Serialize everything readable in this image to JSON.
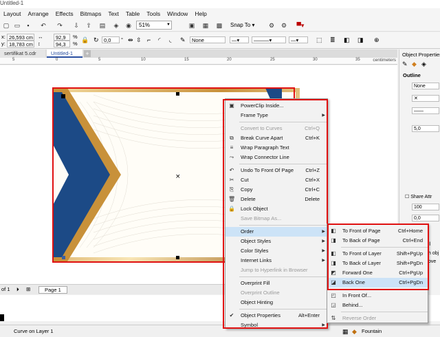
{
  "window": {
    "title": "Untitled-1"
  },
  "menubar": [
    "Layout",
    "Arrange",
    "Effects",
    "Bitmaps",
    "Text",
    "Table",
    "Tools",
    "Window",
    "Help"
  ],
  "toolbar": {
    "zoom": "51%",
    "snap_to": "Snap To"
  },
  "propbar": {
    "x": "26,593 cm",
    "y": "18,783 cm",
    "scale_w": "92,9",
    "scale_h": "94,3",
    "pct": "%",
    "rotation": "0,0",
    "degree": "°",
    "outline_width": "None"
  },
  "doc_tabs": {
    "inactive": "sertifikat 5.cdr",
    "active": "Untitled-1",
    "add": "+"
  },
  "ruler": {
    "labels": [
      "5",
      "0",
      "5",
      "10",
      "15",
      "20",
      "25",
      "30",
      "35"
    ],
    "unit": "centimeters"
  },
  "docker": {
    "title": "Object Properties",
    "section": "Outline",
    "fill_value": "None",
    "width_value": "5,0",
    "share_attr": "Share Attr",
    "value_100": "100",
    "value_00": "0,0",
    "frag1": "ll",
    "frag2": "h obj",
    "frag3": "ove"
  },
  "context_menu": {
    "items": [
      {
        "label": "PowerClip Inside...",
        "icon": "powerclip-icon",
        "shortcut": "",
        "submenu": false,
        "disabled": false
      },
      {
        "label": "Frame Type",
        "icon": "",
        "shortcut": "",
        "submenu": true,
        "disabled": false
      },
      {
        "sep": true
      },
      {
        "label": "Convert to Curves",
        "icon": "",
        "shortcut": "Ctrl+Q",
        "submenu": false,
        "disabled": true
      },
      {
        "label": "Break Curve Apart",
        "icon": "break-apart-icon",
        "shortcut": "Ctrl+K",
        "submenu": false,
        "disabled": false
      },
      {
        "label": "Wrap Paragraph Text",
        "icon": "wrap-text-icon",
        "shortcut": "",
        "submenu": false,
        "disabled": false
      },
      {
        "label": "Wrap Connector Line",
        "icon": "connector-icon",
        "shortcut": "",
        "submenu": false,
        "disabled": false
      },
      {
        "sep": true
      },
      {
        "label": "Undo To Front Of Page",
        "icon": "undo-icon",
        "shortcut": "Ctrl+Z",
        "submenu": false,
        "disabled": false
      },
      {
        "label": "Cut",
        "icon": "scissors-icon",
        "shortcut": "Ctrl+X",
        "submenu": false,
        "disabled": false
      },
      {
        "label": "Copy",
        "icon": "copy-icon",
        "shortcut": "Ctrl+C",
        "submenu": false,
        "disabled": false
      },
      {
        "label": "Delete",
        "icon": "trash-icon",
        "shortcut": "Delete",
        "submenu": false,
        "disabled": false
      },
      {
        "label": "Lock Object",
        "icon": "lock-icon",
        "shortcut": "",
        "submenu": false,
        "disabled": false
      },
      {
        "label": "Save Bitmap As...",
        "icon": "",
        "shortcut": "",
        "submenu": false,
        "disabled": true
      },
      {
        "sep": true
      },
      {
        "label": "Order",
        "icon": "",
        "shortcut": "",
        "submenu": true,
        "disabled": false,
        "highlight": true
      },
      {
        "label": "Object Styles",
        "icon": "",
        "shortcut": "",
        "submenu": true,
        "disabled": false
      },
      {
        "label": "Color Styles",
        "icon": "",
        "shortcut": "",
        "submenu": true,
        "disabled": false
      },
      {
        "label": "Internet Links",
        "icon": "",
        "shortcut": "",
        "submenu": true,
        "disabled": false
      },
      {
        "label": "Jump to Hyperlink in Browser",
        "icon": "",
        "shortcut": "",
        "submenu": false,
        "disabled": true
      },
      {
        "sep": true
      },
      {
        "label": "Overprint Fill",
        "icon": "",
        "shortcut": "",
        "submenu": false,
        "disabled": false
      },
      {
        "label": "Overprint Outline",
        "icon": "",
        "shortcut": "",
        "submenu": false,
        "disabled": true
      },
      {
        "label": "Object Hinting",
        "icon": "",
        "shortcut": "",
        "submenu": false,
        "disabled": false
      },
      {
        "sep": true
      },
      {
        "label": "Object Properties",
        "icon": "check-icon",
        "shortcut": "Alt+Enter",
        "submenu": false,
        "disabled": false
      },
      {
        "label": "Symbol",
        "icon": "",
        "shortcut": "",
        "submenu": true,
        "disabled": false
      }
    ]
  },
  "order_submenu": {
    "items": [
      {
        "label": "To Front of Page",
        "shortcut": "Ctrl+Home",
        "disabled": false,
        "icon": "front-page-icon"
      },
      {
        "label": "To Back of Page",
        "shortcut": "Ctrl+End",
        "disabled": false,
        "icon": "back-page-icon"
      },
      {
        "sep": true
      },
      {
        "label": "To Front of Layer",
        "shortcut": "Shift+PgUp",
        "disabled": false,
        "icon": "front-layer-icon"
      },
      {
        "label": "To Back of Layer",
        "shortcut": "Shift+PgDn",
        "disabled": false,
        "icon": "back-layer-icon"
      },
      {
        "label": "Forward One",
        "shortcut": "Ctrl+PgUp",
        "disabled": false,
        "icon": "forward-one-icon"
      },
      {
        "label": "Back One",
        "shortcut": "Ctrl+PgDn",
        "disabled": false,
        "highlight": true,
        "icon": "back-one-icon"
      },
      {
        "sep": true
      },
      {
        "label": "In Front Of...",
        "shortcut": "",
        "disabled": false,
        "icon": "in-front-of-icon"
      },
      {
        "label": "Behind...",
        "shortcut": "",
        "disabled": false,
        "icon": "behind-icon"
      },
      {
        "sep": true
      },
      {
        "label": "Reverse Order",
        "shortcut": "",
        "disabled": true,
        "icon": "reverse-order-icon"
      }
    ]
  },
  "pagebar": {
    "pos": "of 1",
    "page": "Page 1"
  },
  "status": {
    "text": "Curve on Layer 1",
    "fill": "Fountain"
  },
  "colors": {
    "navy": "#1c4a86",
    "gold": "#c8913a",
    "red": "#e01010",
    "highlight": "#cce3f7"
  }
}
